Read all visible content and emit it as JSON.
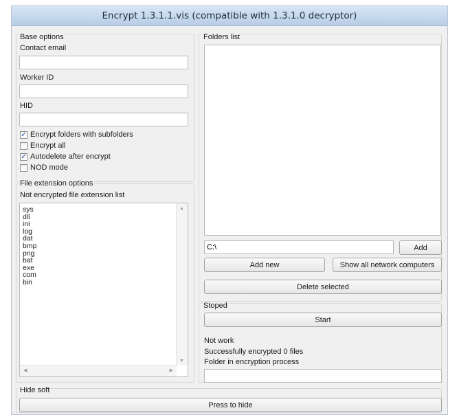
{
  "window": {
    "title": "Encrypt 1.3.1.1.vis (compatible with 1.3.1.0 decryptor)"
  },
  "base_options": {
    "group_label": "Base options",
    "contact_email_label": "Contact email",
    "contact_email_value": "",
    "worker_id_label": "Worker ID",
    "worker_id_value": "",
    "hid_label": "HID",
    "hid_value": "",
    "checkboxes": [
      {
        "label": "Encrypt folders with subfolders",
        "checked": true
      },
      {
        "label": "Encrypt all",
        "checked": false
      },
      {
        "label": "Autodelete after encrypt",
        "checked": true
      },
      {
        "label": "NOD mode",
        "checked": false
      }
    ]
  },
  "file_extension": {
    "group_label": "File extension options",
    "list_label": "Not encrypted file extension list",
    "items": [
      "sys",
      "dll",
      "ini",
      "log",
      "dat",
      "bmp",
      "png",
      "bat",
      "exe",
      "com",
      "bin"
    ]
  },
  "folders": {
    "group_label": "Folders list",
    "path_value": "C:\\",
    "add_label": "Add",
    "add_new_label": "Add new",
    "show_network_label": "Show all network computers",
    "delete_selected_label": "Delete selected"
  },
  "status": {
    "group_label": "Stoped",
    "start_label": "Start",
    "work_state": "Not work",
    "encrypted_count": "Successfully encrypted 0 files",
    "folder_process_label": "Folder in encryption process",
    "folder_process_value": ""
  },
  "hide": {
    "group_label": "Hide soft",
    "button_label": "Press to hide"
  },
  "icons": {
    "check": "checkmark-icon",
    "scroll_up": "scroll-up-arrow-icon",
    "scroll_down": "scroll-down-arrow-icon",
    "scroll_left": "scroll-left-arrow-icon",
    "scroll_right": "scroll-right-arrow-icon"
  }
}
